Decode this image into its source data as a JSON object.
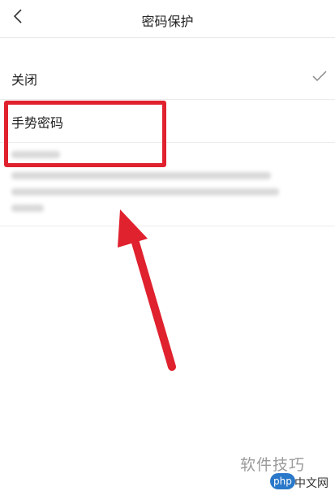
{
  "header": {
    "title": "密码保护"
  },
  "options": [
    {
      "label": "关闭",
      "selected": true
    },
    {
      "label": "手势密码",
      "selected": false
    }
  ],
  "highlight_color": "#e0212e",
  "watermark": {
    "text": "软件技巧",
    "logo": "php",
    "logo_suffix": "中文网"
  }
}
